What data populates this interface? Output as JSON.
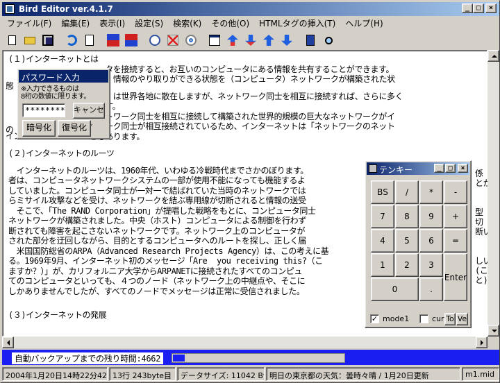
{
  "window": {
    "title": "Bird Editor ver.4.1.7"
  },
  "menu": [
    "ファイル(F)",
    "編集(E)",
    "表示(I)",
    "設定(S)",
    "検索(K)",
    "その他(O)",
    "HTMLタグの挿入(T)",
    "ヘルプ(H)"
  ],
  "toolbar_icons": [
    "new-file-icon",
    "open-folder-icon",
    "save-icon",
    "undo-icon",
    "print-preview-icon",
    "back-icon",
    "back-alt-icon",
    "clock-icon",
    "delete-icon",
    "target-icon",
    "properties-icon",
    "auto-up-icon",
    "auto-down-icon",
    "sort-up-icon",
    "sort-down-icon",
    "calculator-icon",
    "search-icon"
  ],
  "editor": {
    "lines": [
      "(１)インターネットとは",
      "　　　　　　　　　　ュータを接続すると、お互いのコンピュータにある情報を共有することができます。",
      "　　　　　　　　　　され、情報のやり取りができる状態を（コンピュータ）ネットワークが構築された状",
      "",
      "　　　　　　　　　　　　　は世界各地に散在しますが、ネットワーク同士を相互に接続すれば、さらに多く",
      "　　　　　　　　　　ります。",
      "　　　　　　　　　　ネットワーク同士を相互に接続して構築された世界的規模の巨大なネットワークがイ",
      "　　　　　　　　　　トワーク同士が相互接続されているため、インターネットは「ネットワークのネット",
      "　　　　　　　　　　ともあります。",
      "",
      "(２)インターネットのルーツ",
      "",
      "　インターネットのルーツは、1960年代、いわゆる冷戦時代までさかのぼります。",
      "者は、コンピュータネットワークシステムの一部が使用不能になっても機能するよ",
      "していました。コンピュータ同士が一対一で結ばれていた当時のネットワークでは",
      "らミサイル攻撃などを受け、ネットワークを結ぶ専用線が切断されると情報の送受",
      "　そこで、「The RAND Corporation」が提唱した戦略をもとに、コンピュータ同士",
      "ネットワークが構築されました。中央（ホスト）コンピュータによる制御を行わず",
      "断されても障害を起こさないネットワークです。ネットワーク上のコンピュータが",
      "された部分を迂回しながら、目的とするコンピュータへのルートを探し、正しく届",
      "　米国国防総省のARPA（Advanced Research Projects Agency）は、この考えに基",
      "る。1969年9月、インターネット初のメッセージ「Are  you receiving this?（こ",
      "ますか？）」が、カリフォルニア大学からARPANETに接続されたすべてのコンピュ",
      "てのコンピュータといっても、４つのノード（ネットワーク上の中継点や、そこに",
      "しかありませんでしたが、すべてのノードでメッセージは正常に受信されました。",
      "",
      "",
      "(３)インターネットの発展"
    ],
    "right_edge": [
      "係",
      "とか",
      "",
      "",
      "型",
      "切",
      "断い",
      "",
      "",
      "しい",
      "(こ",
      "と)"
    ]
  },
  "left_edge": [
    "態",
    "",
    "の",
    "イン"
  ],
  "password_dialog": {
    "title": "パスワード入力",
    "note1": "※入力できるものは",
    "note2": "8桁の数値に限ります。",
    "value": "********",
    "cancel": "キャンセル",
    "encrypt": "暗号化",
    "decrypt": "復号化"
  },
  "keypad": {
    "title": "テンキー",
    "keys": [
      "BS",
      "/",
      "*",
      "-",
      "7",
      "8",
      "9",
      "+",
      "4",
      "5",
      "6",
      "=",
      "1",
      "2",
      "3",
      "Enter",
      "0",
      "."
    ],
    "mode_label": "mode1",
    "mode_checked": true,
    "cur_label": "cur",
    "cur_checked": false,
    "btn_to": "To",
    "btn_ve": "Ve"
  },
  "backup": {
    "label": "自動バックアップまでの残り時間:4662",
    "progress": 0.07
  },
  "status": [
    "2004年1月20日14時22分42秒",
    "13行 243byte目",
    "データサイズ: 11042 Byte",
    "明日の東京都の天気：曇時々晴 / 1月20日更新",
    "m1.mid"
  ]
}
